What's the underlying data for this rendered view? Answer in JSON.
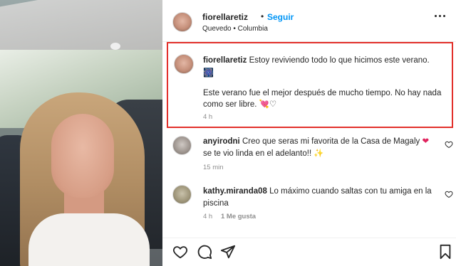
{
  "post": {
    "username": "fiorellaretiz",
    "follow_label": "Seguir",
    "separator": "•",
    "location": "Quevedo • Columbia"
  },
  "caption": {
    "username": "fiorellaretiz",
    "line1": "Estoy reviviendo todo lo que hicimos este verano.",
    "emoji1": "🎆",
    "line2": "Este verano fue el mejor después de mucho tiempo. No hay nada",
    "line3": "como ser libre. 💘♡",
    "time": "4 h"
  },
  "comments": [
    {
      "username": "anyirodni",
      "line1": "Creo que seras mi favorita de la Casa de Magaly",
      "heart": "❤",
      "line2": "se te vio linda en el adelanto!! ✨",
      "time": "15 min",
      "likes": ""
    },
    {
      "username": "kathy.miranda08",
      "line1": "Lo máximo cuando saltas con tu amiga en la",
      "line2": "piscina",
      "time": "4 h",
      "likes": "1 Me gusta"
    }
  ],
  "colors": {
    "accent": "#0095f6",
    "highlight_border": "#e2302b",
    "muted_text": "#8e8e8e"
  },
  "icons": [
    "more-options-icon",
    "heart-icon",
    "comment-icon",
    "share-icon",
    "bookmark-icon",
    "like-comment-icon"
  ]
}
